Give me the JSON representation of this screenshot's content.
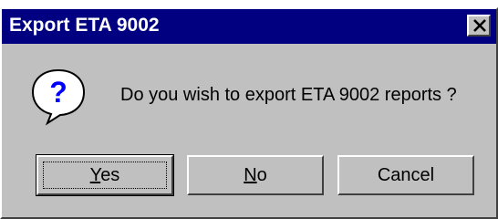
{
  "dialog": {
    "title": "Export ETA 9002",
    "message": "Do you wish to export ETA 9002 reports ?",
    "icon": "question-icon"
  },
  "titlebar": {
    "close_icon": "close-icon"
  },
  "buttons": {
    "yes": {
      "mnemonic": "Y",
      "rest": "es"
    },
    "no": {
      "mnemonic": "N",
      "rest": "o"
    },
    "cancel": {
      "label": "Cancel"
    }
  },
  "colors": {
    "titlebar": "#000080",
    "face": "#c0c0c0",
    "icon_blue": "#0000ff"
  }
}
